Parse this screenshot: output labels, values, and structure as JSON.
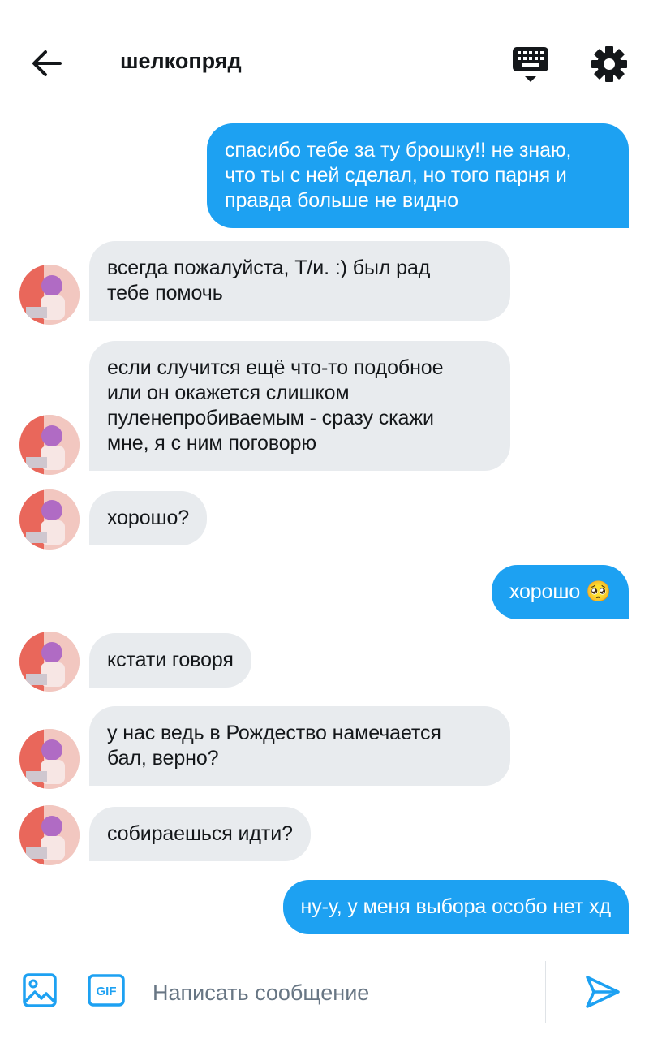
{
  "header": {
    "title": "шелкопряд",
    "back_icon": "arrow-left-icon",
    "keyboard_icon": "keyboard-icon",
    "settings_icon": "gear-icon"
  },
  "messages": [
    {
      "side": "out",
      "text": "спасибо тебе за ту брошку!! не знаю,\nчто ты с ней сделал, но того парня и\nправда больше не видно"
    },
    {
      "side": "in",
      "text": "всегда пожалуйста, Т/и. :) был рад\nтебе помочь"
    },
    {
      "side": "in",
      "text": "если случится ещё что-то подобное\nили он окажется слишком\nпуленепробиваемым - сразу скажи\nмне, я с ним поговорю"
    },
    {
      "side": "in",
      "text": "хорошо?"
    },
    {
      "side": "out",
      "text": "хорошо 🥺"
    },
    {
      "side": "in",
      "text": "кстати говоря"
    },
    {
      "side": "in",
      "text": "у нас ведь в Рождество намечается\nбал, верно?"
    },
    {
      "side": "in",
      "text": "собираешься идти?"
    },
    {
      "side": "out",
      "text": "ну-у, у меня выбора особо нет хд"
    }
  ],
  "composer": {
    "placeholder": "Написать сообщение",
    "image_icon": "image-icon",
    "gif_label": "GIF",
    "send_icon": "send-icon"
  },
  "colors": {
    "accent": "#1da1f2",
    "incoming_bubble": "#e8ebee"
  }
}
